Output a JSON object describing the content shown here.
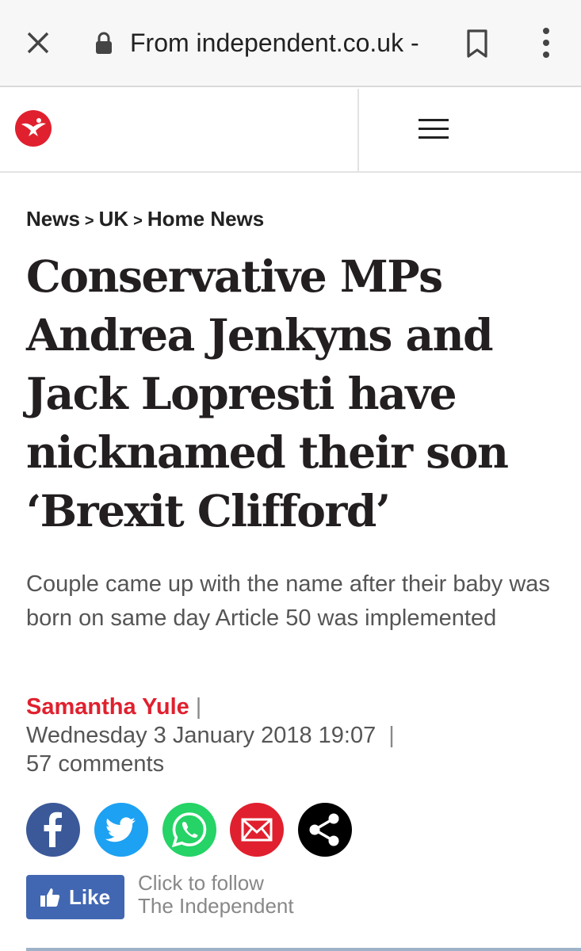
{
  "browser": {
    "url": "From independent.co.uk -",
    "icons": [
      "close-icon",
      "lock-icon",
      "bookmark-icon",
      "menu-dots-icon"
    ]
  },
  "header": {
    "logo": "independent-eagle-logo",
    "menu_icon": "hamburger-icon",
    "logo_color": "#e0202e"
  },
  "breadcrumb": {
    "items": [
      "News",
      "UK",
      "Home News"
    ],
    "separator": ">"
  },
  "article": {
    "headline_lines": [
      "Conservative MPs",
      "Andrea Jenkyns and",
      "Jack Lopresti have",
      "nicknamed their son",
      "‘Brexit Clifford’"
    ],
    "standfirst": "Couple came up with the name after their baby was born on same day Article 50 was implemented",
    "author": "Samantha Yule",
    "date": "Wednesday 3 January 2018 19:07",
    "comments": "57 comments",
    "separator": "|"
  },
  "share": {
    "buttons": [
      {
        "name": "facebook",
        "icon": "facebook-icon",
        "color": "#3b5998"
      },
      {
        "name": "twitter",
        "icon": "twitter-icon",
        "color": "#1da1f2"
      },
      {
        "name": "whatsapp",
        "icon": "whatsapp-icon",
        "color": "#25d366"
      },
      {
        "name": "email",
        "icon": "email-icon",
        "color": "#e0202e"
      },
      {
        "name": "share",
        "icon": "share-icon",
        "color": "#000000"
      }
    ]
  },
  "like": {
    "label": "Like",
    "follow_line1": "Click to follow",
    "follow_line2": "The Independent",
    "color": "#4267b2"
  }
}
